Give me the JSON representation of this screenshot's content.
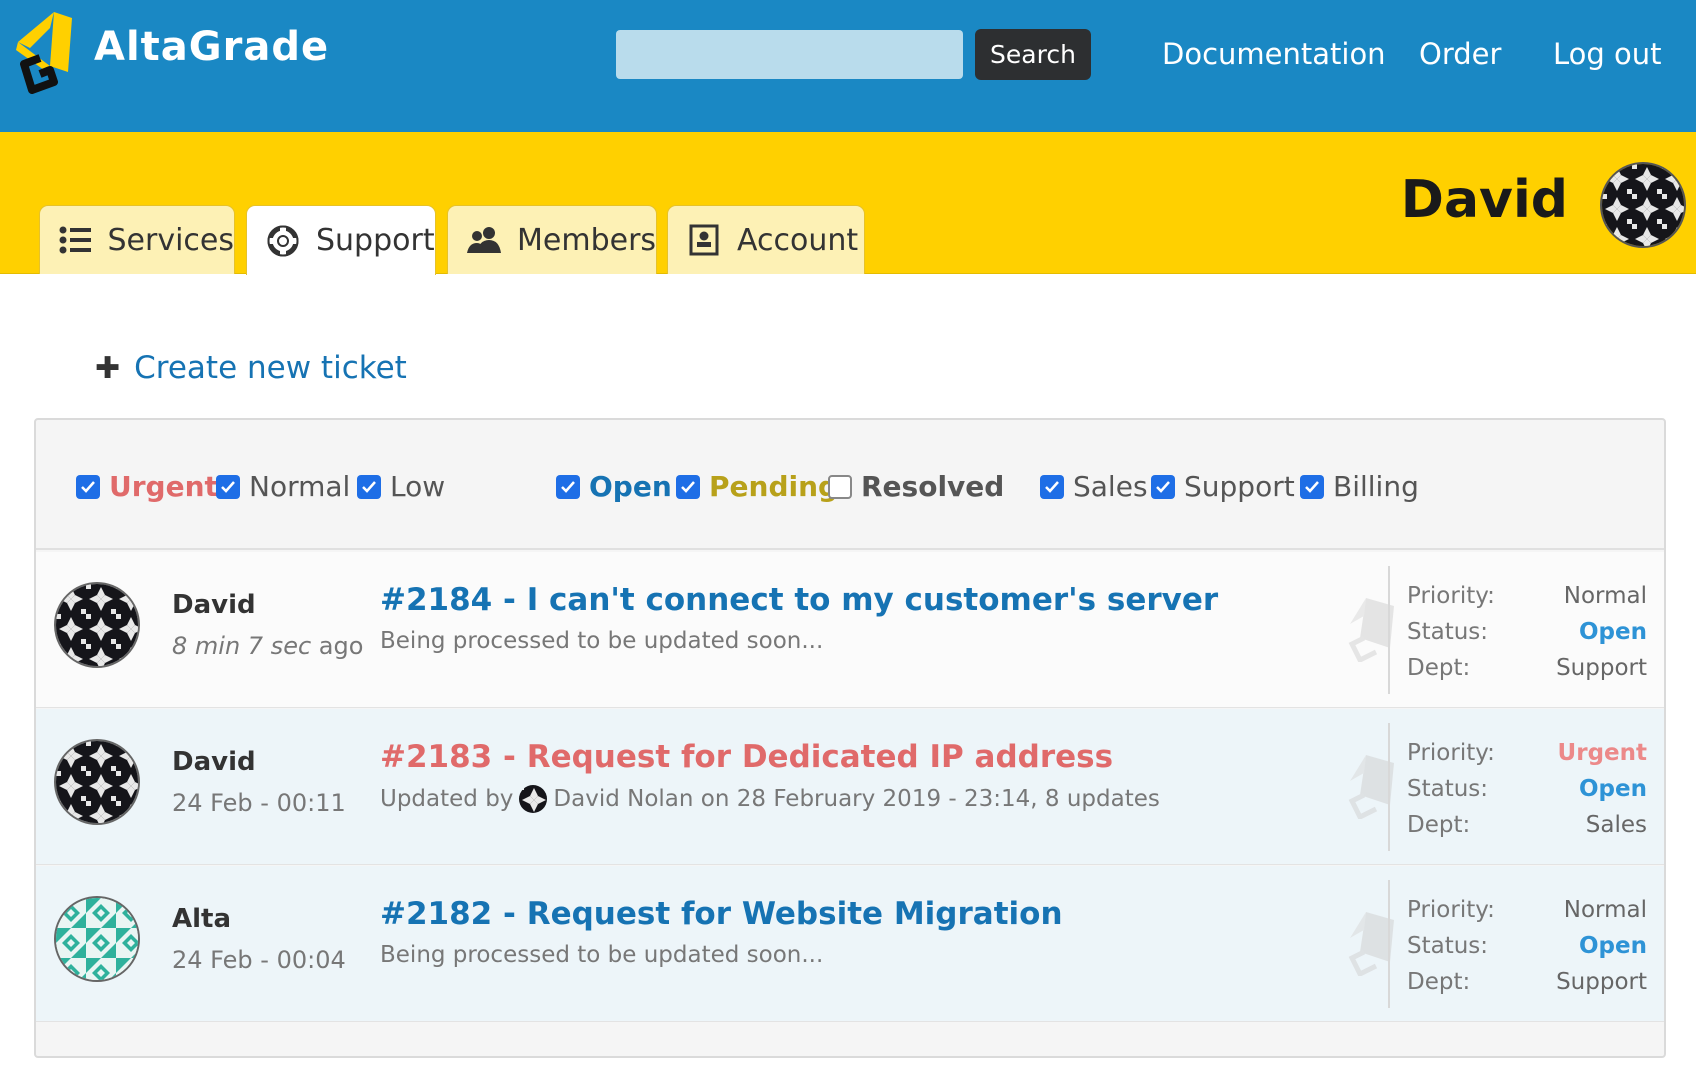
{
  "header": {
    "brand": "AltaGrade",
    "search": {
      "placeholder": "",
      "button_label": "Search"
    },
    "nav": {
      "documentation": "Documentation",
      "order": "Order",
      "logout": "Log out"
    }
  },
  "tabs": [
    {
      "label": "Services",
      "icon": "list-icon",
      "active": false
    },
    {
      "label": "Support",
      "icon": "lifebuoy-icon",
      "active": true
    },
    {
      "label": "Members",
      "icon": "members-icon",
      "active": false
    },
    {
      "label": "Account",
      "icon": "account-card-icon",
      "active": false
    }
  ],
  "user": {
    "name": "David"
  },
  "create_ticket": {
    "label": "Create new ticket"
  },
  "filters": {
    "priority": [
      {
        "label": "Urgent",
        "checked": true
      },
      {
        "label": "Normal",
        "checked": true
      },
      {
        "label": "Low",
        "checked": true
      }
    ],
    "status": [
      {
        "label": "Open",
        "checked": true
      },
      {
        "label": "Pending",
        "checked": true
      },
      {
        "label": "Resolved",
        "checked": false
      }
    ],
    "department": [
      {
        "label": "Sales",
        "checked": true
      },
      {
        "label": "Support",
        "checked": true
      },
      {
        "label": "Billing",
        "checked": true
      }
    ]
  },
  "meta_labels": {
    "priority": "Priority:",
    "status": "Status:",
    "dept": "Dept:"
  },
  "tickets": [
    {
      "author": "David",
      "time_prefix": "8 min 7 sec",
      "time_suffix": " ago",
      "title": "#2184 - I can't connect to my customer's server",
      "subtitle": "Being processed to be updated soon...",
      "priority": "Normal",
      "status": "Open",
      "dept": "Support"
    },
    {
      "author": "David",
      "time": "24 Feb - 00:11",
      "title": "#2183 - Request for Dedicated IP address",
      "subtitle_prefix": "Updated by",
      "subtitle_rest": "David Nolan on 28 February 2019 - 23:14, 8 updates",
      "priority": "Urgent",
      "status": "Open",
      "dept": "Sales"
    },
    {
      "author": "Alta",
      "time": "24 Feb - 00:04",
      "title": "#2182 - Request for Website Migration",
      "subtitle": "Being processed to be updated soon...",
      "priority": "Normal",
      "status": "Open",
      "dept": "Support"
    }
  ],
  "colors": {
    "header_blue": "#1a88c4",
    "band_yellow": "#ffd000",
    "link_blue": "#1673b3",
    "urgent_red": "#e06a6a",
    "open_blue": "#2e93d6",
    "pending_olive": "#b8a11a"
  }
}
